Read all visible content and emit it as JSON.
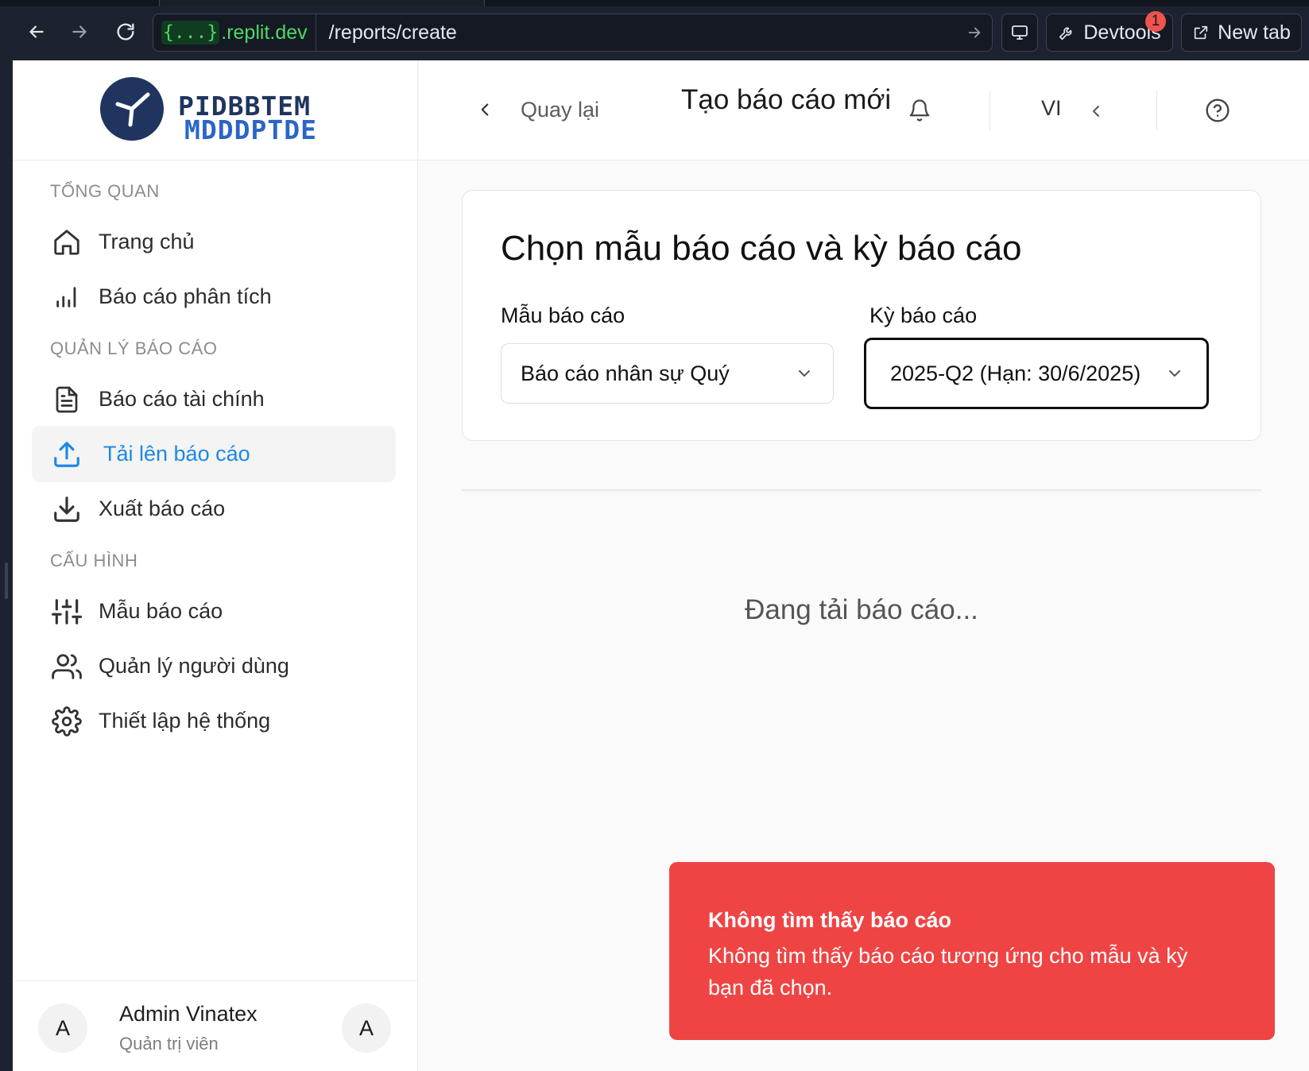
{
  "browser": {
    "url_badge": "{...}",
    "url_domain": ".replit.dev",
    "url_path": "/reports/create",
    "devtools_label": "Devtools",
    "devtools_badge": "1",
    "newtab_label": "New tab"
  },
  "sidebar": {
    "logo_line1": "PIDBBTEM",
    "logo_line2": "MDDDPTDE",
    "sections": [
      {
        "title": "TỔNG QUAN",
        "items": [
          {
            "label": "Trang chủ",
            "icon": "home-icon"
          },
          {
            "label": "Báo cáo phân tích",
            "icon": "bar-chart-icon"
          }
        ]
      },
      {
        "title": "QUẢN LÝ BÁO CÁO",
        "items": [
          {
            "label": "Báo cáo tài chính",
            "icon": "file-text-icon"
          },
          {
            "label": "Tải lên báo cáo",
            "icon": "upload-icon",
            "active": true
          },
          {
            "label": "Xuất báo cáo",
            "icon": "download-icon"
          }
        ]
      },
      {
        "title": "CẤU HÌNH",
        "items": [
          {
            "label": "Mẫu báo cáo",
            "icon": "sliders-icon"
          },
          {
            "label": "Quản lý người dùng",
            "icon": "users-icon"
          },
          {
            "label": "Thiết lập hệ thống",
            "icon": "settings-icon"
          }
        ]
      }
    ],
    "user": {
      "initial": "A",
      "name": "Admin Vinatex",
      "role": "Quản trị viên",
      "right_initial": "A"
    }
  },
  "topbar": {
    "back_label": "Quay lại",
    "title": "Tạo báo cáo mới",
    "language": "VI"
  },
  "form": {
    "title": "Chọn mẫu báo cáo và kỳ báo cáo",
    "template_label": "Mẫu báo cáo",
    "template_value": "Báo cáo nhân sự Quý",
    "period_label": "Kỳ báo cáo",
    "period_value": "2025-Q2 (Hạn: 30/6/2025)"
  },
  "main": {
    "loading_text": "Đang tải báo cáo..."
  },
  "toast": {
    "title": "Không tìm thấy báo cáo",
    "description": "Không tìm thấy báo cáo tương ứng cho mẫu và kỳ bạn đã chọn.",
    "color": "#ef4444"
  },
  "colors": {
    "accent": "#1f88e5",
    "brand_dark": "#1f3560",
    "brand_blue": "#2a65c8"
  }
}
